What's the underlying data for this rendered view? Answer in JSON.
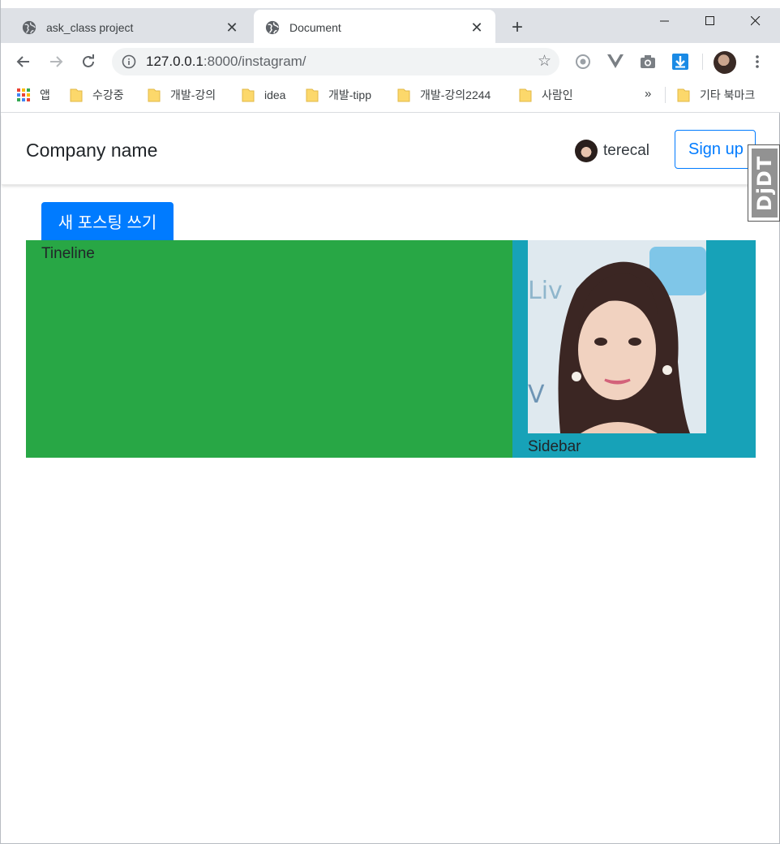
{
  "browser": {
    "tabs": [
      {
        "title": "ask_class project",
        "active": false
      },
      {
        "title": "Document",
        "active": true
      }
    ],
    "new_tab_label": "+",
    "address": {
      "host": "127.0.0.1",
      "rest": ":8000/instagram/"
    },
    "bookmarks": [
      {
        "label": "앱",
        "icon": "apps-grid-icon"
      },
      {
        "label": "수강중",
        "icon": "folder-icon"
      },
      {
        "label": "개발-강의",
        "icon": "folder-icon"
      },
      {
        "label": "idea",
        "icon": "folder-icon"
      },
      {
        "label": "개발-tipp",
        "icon": "folder-icon"
      },
      {
        "label": "개발-강의2244",
        "icon": "folder-icon"
      },
      {
        "label": "사람인",
        "icon": "folder-icon"
      }
    ],
    "bookmarks_overflow": "»",
    "other_bookmarks": "기타 북마크"
  },
  "page": {
    "brand": "Company name",
    "username": "terecal",
    "signup_label": "Sign up",
    "new_post_label": "새 포스팅 쓰기",
    "timeline_label": "Tineline",
    "sidebar_label": "Sidebar",
    "debug_toolbar_label": "DjDT"
  },
  "colors": {
    "primary": "#007bff",
    "timeline_bg": "#28a745",
    "sidebar_bg": "#17a2b8",
    "tabstrip_bg": "#dee1e6"
  }
}
